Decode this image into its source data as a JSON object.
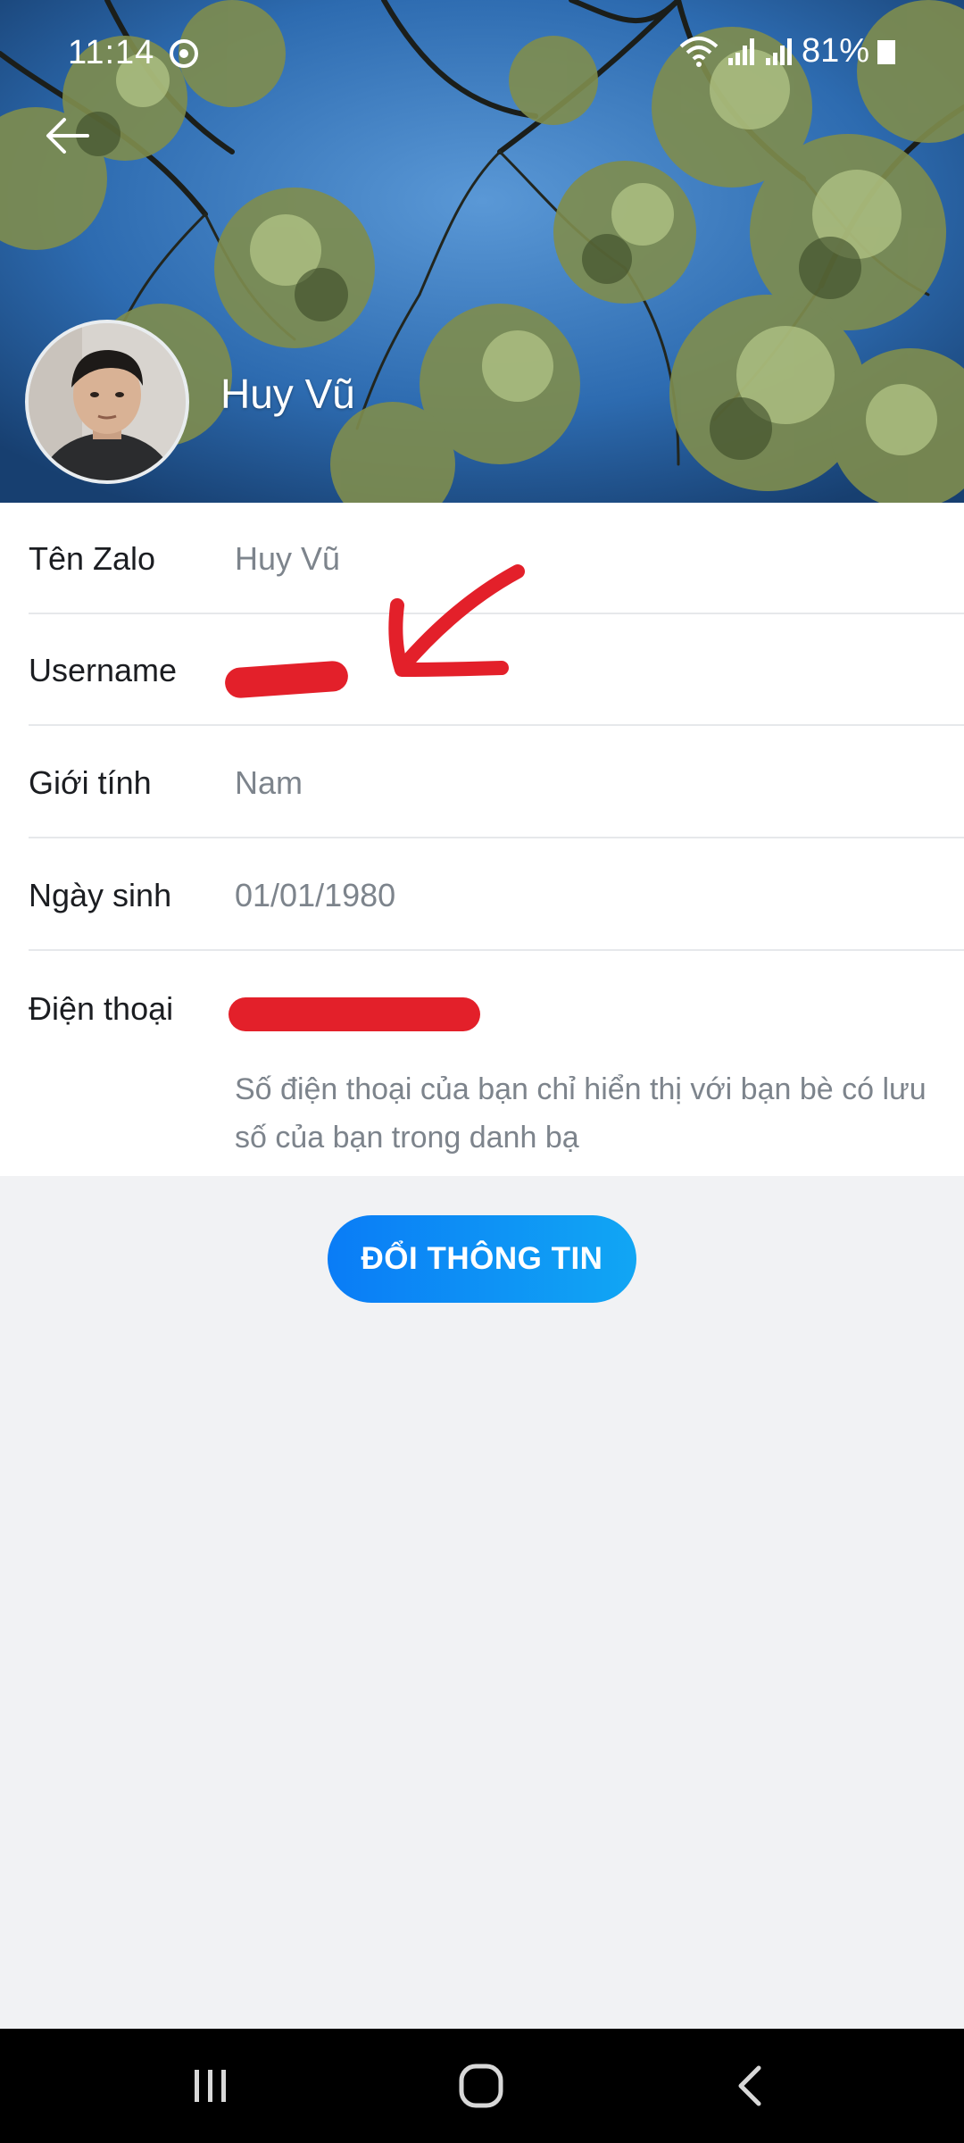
{
  "status_bar": {
    "time": "11:14",
    "battery_percent": "81%",
    "icons": [
      "sync-icon",
      "wifi-icon",
      "signal-icon",
      "signal-icon",
      "battery-icon"
    ]
  },
  "header": {
    "back_icon": "arrow-left-icon",
    "profile_name": "Huy Vũ"
  },
  "info": {
    "rows": [
      {
        "label": "Tên Zalo",
        "value": "Huy Vũ"
      },
      {
        "label": "Username",
        "value": ""
      },
      {
        "label": "Giới tính",
        "value": "Nam"
      },
      {
        "label": "Ngày sinh",
        "value": "01/01/1980"
      }
    ],
    "phone": {
      "label": "Điện thoại",
      "value": "",
      "note": "Số điện thoại của bạn chỉ hiển thị với bạn bè có lưu số của bạn trong danh bạ"
    }
  },
  "actions": {
    "edit_label": "ĐỔI THÔNG TIN"
  },
  "navbar": {
    "icons": [
      "recent-apps-icon",
      "home-icon",
      "back-nav-icon"
    ]
  },
  "colors": {
    "accent": "#0a7cf6",
    "redaction": "#e3202a",
    "label_text": "#1b1d21",
    "value_text": "#7d848c",
    "page_background": "#f1f2f4"
  }
}
